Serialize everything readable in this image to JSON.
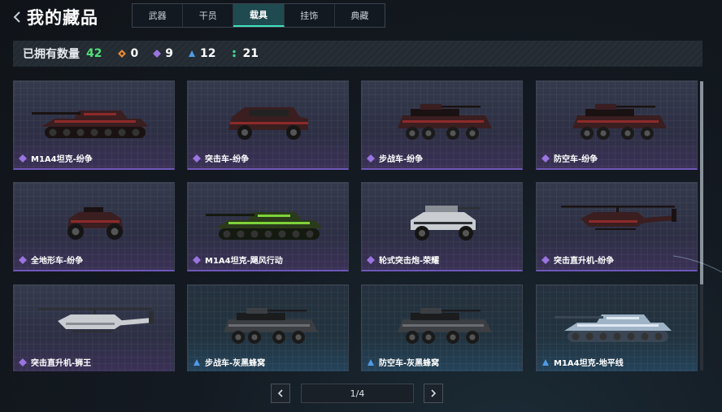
{
  "header": {
    "title": "我的藏品",
    "tabs": [
      {
        "label": "武器",
        "active": false
      },
      {
        "label": "干员",
        "active": false
      },
      {
        "label": "载具",
        "active": true
      },
      {
        "label": "挂饰",
        "active": false
      },
      {
        "label": "典藏",
        "active": false
      }
    ]
  },
  "stats": {
    "label": "已拥有数量",
    "total": "42",
    "items": [
      {
        "icon": "orange-diamond-icon",
        "color": "#e58a3a",
        "value": "0"
      },
      {
        "icon": "purple-diamond-icon",
        "color": "#9a74e0",
        "value": "9"
      },
      {
        "icon": "blue-triangle-icon",
        "color": "#4e9be6",
        "value": "12"
      },
      {
        "icon": "green-dots-icon",
        "color": "#44d68a",
        "value": "21"
      }
    ]
  },
  "cards": [
    {
      "name": "M1A4坦克-纷争",
      "rarity": "purple",
      "vehicle": "tank",
      "paint": "red"
    },
    {
      "name": "突击车-纷争",
      "rarity": "purple",
      "vehicle": "suv",
      "paint": "red"
    },
    {
      "name": "步战车-纷争",
      "rarity": "purple",
      "vehicle": "apc",
      "paint": "red"
    },
    {
      "name": "防空车-纷争",
      "rarity": "purple",
      "vehicle": "apc",
      "paint": "red"
    },
    {
      "name": "全地形车-纷争",
      "rarity": "purple",
      "vehicle": "atv",
      "paint": "red"
    },
    {
      "name": "M1A4坦克-飓风行动",
      "rarity": "purple",
      "vehicle": "tank",
      "paint": "green"
    },
    {
      "name": "轮式突击炮-荣耀",
      "rarity": "purple",
      "vehicle": "buggy",
      "paint": "white"
    },
    {
      "name": "突击直升机-纷争",
      "rarity": "purple",
      "vehicle": "heli",
      "paint": "red"
    },
    {
      "name": "突击直升机-狮王",
      "rarity": "purple",
      "vehicle": "heli",
      "paint": "white"
    },
    {
      "name": "步战车-灰黑蜂窝",
      "rarity": "blue",
      "vehicle": "apc",
      "paint": "camo"
    },
    {
      "name": "防空车-灰黑蜂窝",
      "rarity": "blue",
      "vehicle": "apc",
      "paint": "camo"
    },
    {
      "name": "M1A4坦克-地平线",
      "rarity": "blue",
      "vehicle": "tank",
      "paint": "ice"
    }
  ],
  "pager": {
    "text": "1/4"
  },
  "colors": {
    "accent": "#3fe0c0",
    "total_green": "#52e07a",
    "purple": "#9a74e0",
    "blue": "#4e9be6"
  }
}
